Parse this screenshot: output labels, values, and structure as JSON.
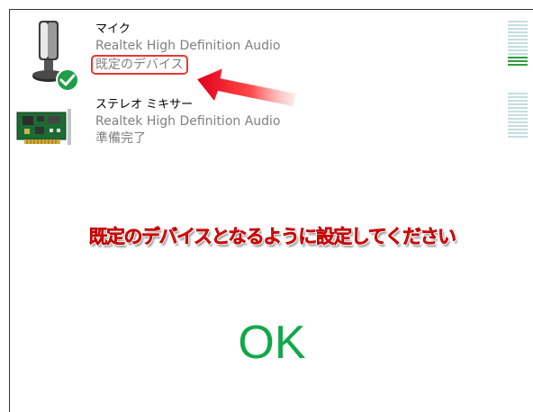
{
  "devices": [
    {
      "name": "マイク",
      "driver": "Realtek High Definition Audio",
      "status": "既定のデバイス",
      "icon": "microphone-icon",
      "badge": "default-device-check-icon",
      "level": 0.25
    },
    {
      "name": "ステレオ ミキサー",
      "driver": "Realtek High Definition Audio",
      "status": "準備完了",
      "icon": "sound-card-icon",
      "level": 0
    }
  ],
  "annotation": {
    "instruction": "既定のデバイスとなるように設定してください",
    "result": "OK"
  },
  "colors": {
    "highlight_red": "#e53935",
    "instruction_red": "#ff2a2a",
    "ok_green": "#10a84a",
    "meter_on": "#2e9e3a",
    "meter_off": "#c5dde1",
    "badge_green": "#1f9d47"
  }
}
